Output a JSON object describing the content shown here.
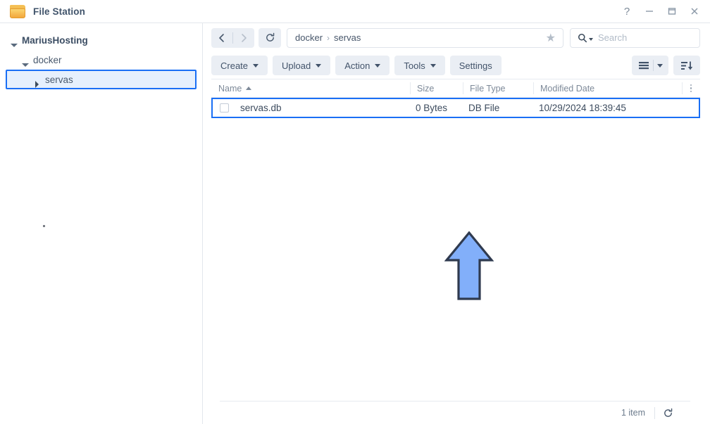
{
  "window": {
    "title": "File Station",
    "app_icon": "folder-icon",
    "controls": {
      "help": "?",
      "minimize": "minimize-icon",
      "maximize": "maximize-icon",
      "close": "close-icon"
    }
  },
  "sidebar": {
    "items": [
      {
        "label": "MariusHosting",
        "level": 0,
        "caret": "down",
        "selected": false
      },
      {
        "label": "docker",
        "level": 1,
        "caret": "down",
        "selected": false
      },
      {
        "label": "servas",
        "level": 2,
        "caret": "right",
        "selected": true
      }
    ]
  },
  "navbar": {
    "back_icon": "chevron-left-icon",
    "forward_icon": "chevron-right-icon",
    "refresh_icon": "refresh-icon",
    "breadcrumb": [
      "docker",
      "servas"
    ],
    "breadcrumb_separator": "›",
    "favorite_icon": "star-icon",
    "search": {
      "icon": "search-icon",
      "value": "",
      "placeholder": "Search"
    }
  },
  "toolbar": {
    "buttons": [
      {
        "label": "Create",
        "has_caret": true
      },
      {
        "label": "Upload",
        "has_caret": true
      },
      {
        "label": "Action",
        "has_caret": true
      },
      {
        "label": "Tools",
        "has_caret": true
      },
      {
        "label": "Settings",
        "has_caret": false
      }
    ],
    "view_icon": "list-view-icon",
    "view_caret_icon": "chevron-down-icon",
    "sort_icon": "sort-descending-icon"
  },
  "filelist": {
    "columns": [
      {
        "key": "name",
        "label": "Name",
        "sort": "asc"
      },
      {
        "key": "size",
        "label": "Size",
        "sort": null
      },
      {
        "key": "type",
        "label": "File Type",
        "sort": null
      },
      {
        "key": "date",
        "label": "Modified Date",
        "sort": null
      }
    ],
    "column_menu_icon": "kebab-menu-icon",
    "rows": [
      {
        "icon": "file-icon",
        "name": "servas.db",
        "size": "0 Bytes",
        "type": "DB File",
        "date": "10/29/2024 18:39:45",
        "selected": true
      }
    ]
  },
  "statusbar": {
    "item_count": "1 item",
    "refresh_icon": "refresh-icon"
  },
  "annotation": {
    "arrow": {
      "direction": "up",
      "fill": "#82AFFA",
      "stroke": "#2f3a4f"
    }
  },
  "colors": {
    "selection_border": "#1a6ff5",
    "selection_fill": "#e6f0fd",
    "toolbar_button": "#eaeef4",
    "text_primary": "#3c4b5e",
    "text_muted": "#7e8a99",
    "divider": "#e7ebf0"
  }
}
